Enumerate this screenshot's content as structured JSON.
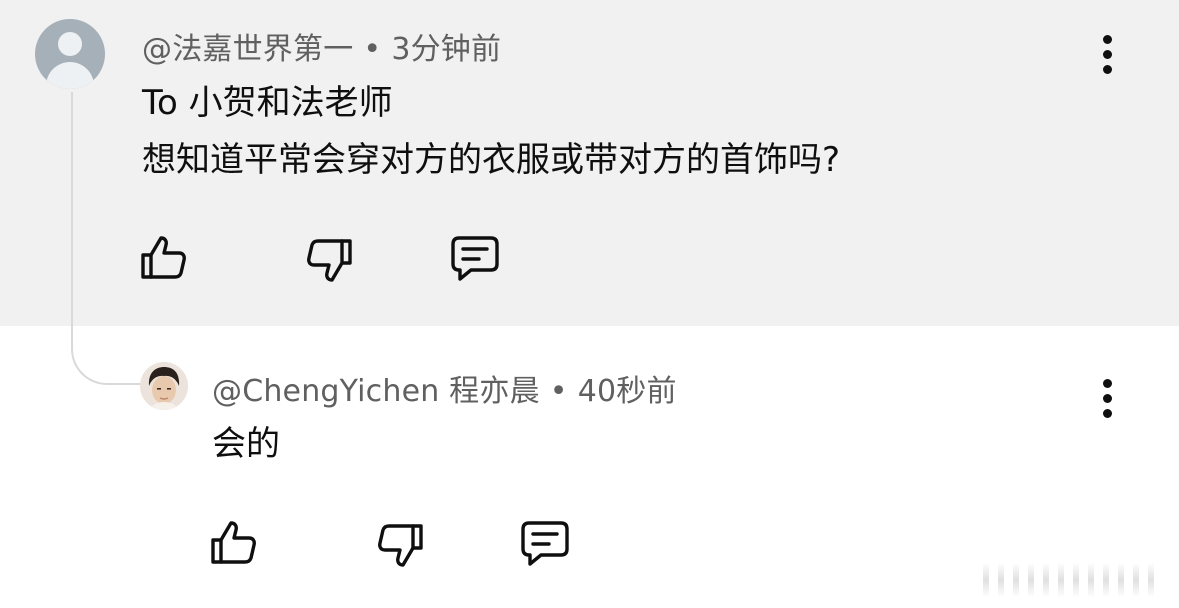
{
  "comments": [
    {
      "author": "@法嘉世界第一",
      "time": "3分钟前",
      "separator": "•",
      "lines": [
        "To 小贺和法老师",
        "想知道平常会穿对方的衣服或带对方的首饰吗?"
      ],
      "avatar_icon": "default-user-avatar"
    }
  ],
  "reply": {
    "author": "@ChengYichen 程亦晨",
    "time": "40秒前",
    "separator": "•",
    "text": "会的",
    "avatar_icon": "user-photo-avatar"
  },
  "icons": {
    "like": "thumbs-up-icon",
    "dislike": "thumbs-down-icon",
    "reply": "comment-icon",
    "more": "more-vert-icon"
  },
  "colors": {
    "highlight_bg": "#f1f1f1",
    "meta_text": "#606060",
    "body_text": "#0f0f0f"
  }
}
